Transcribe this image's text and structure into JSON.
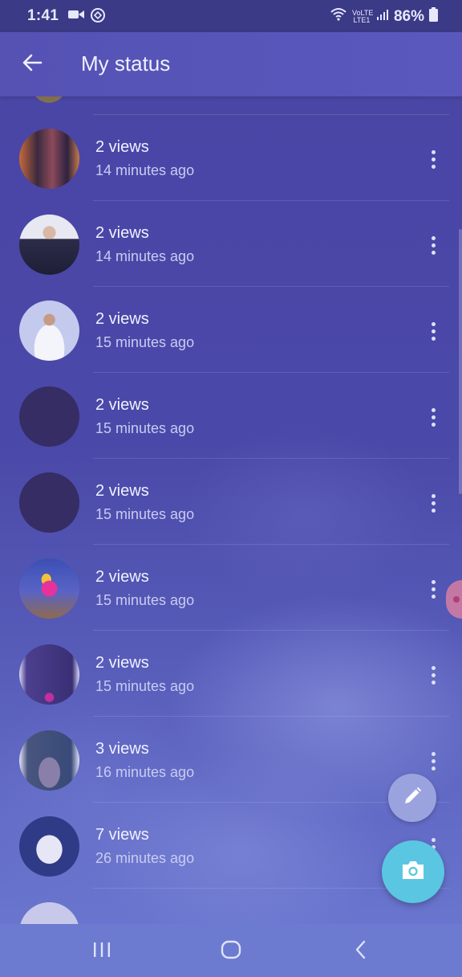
{
  "status_bar": {
    "time": "1:41",
    "battery": "86%",
    "network": "VoLTE LTE1"
  },
  "header": {
    "title": "My status"
  },
  "statuses": [
    {
      "views": "2 views",
      "time": "14 minutes ago"
    },
    {
      "views": "2 views",
      "time": "14 minutes ago"
    },
    {
      "views": "2 views",
      "time": "15 minutes ago"
    },
    {
      "views": "2 views",
      "time": "15 minutes ago"
    },
    {
      "views": "2 views",
      "time": "15 minutes ago"
    },
    {
      "views": "2 views",
      "time": "15 minutes ago"
    },
    {
      "views": "2 views",
      "time": "15 minutes ago"
    },
    {
      "views": "3 views",
      "time": "16 minutes ago"
    },
    {
      "views": "7 views",
      "time": "26 minutes ago"
    }
  ],
  "fabs": {
    "pencil": "pencil-icon",
    "camera": "camera-icon"
  },
  "colors": {
    "accent": "#5bc6e2",
    "app_bar": "#5552b4",
    "background": "#4a48a8"
  }
}
